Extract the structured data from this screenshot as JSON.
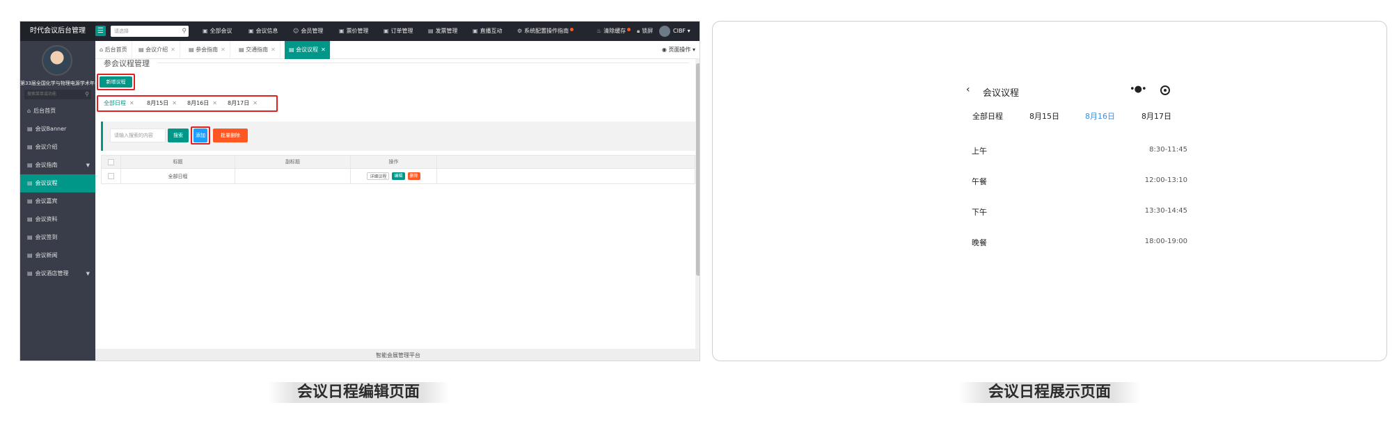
{
  "admin": {
    "brand": "时代会议后台管理",
    "top_search_placeholder": "请选择",
    "nav": [
      "全部会议",
      "会议信息",
      "会员管理",
      "票价管理",
      "订单管理",
      "发票管理",
      "直播互动",
      "系统配置",
      "操作指南",
      "清除缓存",
      "锁屏"
    ],
    "user": "CIBF",
    "sidebar": {
      "conference_name": "第33届全国化学与物理电源学术年会",
      "search_placeholder": "搜索菜单或功能",
      "items": [
        {
          "label": "后台首页"
        },
        {
          "label": "会议Banner"
        },
        {
          "label": "会议介绍"
        },
        {
          "label": "会议指南"
        },
        {
          "label": "会议议程"
        },
        {
          "label": "会议嘉宾"
        },
        {
          "label": "会议资料"
        },
        {
          "label": "会议签到"
        },
        {
          "label": "会议新闻"
        },
        {
          "label": "会议酒店管理"
        }
      ]
    },
    "tabs": [
      "后台首页",
      "会议介绍",
      "参会指南",
      "交通指南",
      "会议议程"
    ],
    "page_ops": "页面操作",
    "legend_title": "参会议程管理",
    "new_schedule": "新增议程",
    "date_tabs": [
      "全部日程",
      "8月15日",
      "8月16日",
      "8月17日"
    ],
    "toolbar": {
      "search_placeholder": "请输入搜索的内容",
      "search": "搜索",
      "add": "添加",
      "batch_delete": "批量删除"
    },
    "table": {
      "headers": [
        "标题",
        "副标题",
        "操作"
      ],
      "rows": [
        {
          "title": "全部日程",
          "subtitle": "",
          "detail": "详细议程",
          "edit": "编辑",
          "delete": "删除"
        }
      ]
    },
    "footer": "智能会展管理平台"
  },
  "display": {
    "title": "会议议程",
    "dates": [
      "全部日程",
      "8月15日",
      "8月16日",
      "8月17日"
    ],
    "active_date_index": 2,
    "slots": [
      {
        "label": "上午",
        "time": "8:30-11:45"
      },
      {
        "label": "午餐",
        "time": "12:00-13:10"
      },
      {
        "label": "下午",
        "time": "13:30-14:45"
      },
      {
        "label": "晚餐",
        "time": "18:00-19:00"
      }
    ]
  },
  "captions": {
    "left": "会议日程编辑页面",
    "right": "会议日程展示页面"
  },
  "colors": {
    "primary": "#009688",
    "danger": "#ff5722",
    "info": "#1e9fff",
    "highlight": "#e02020",
    "active_date": "#3b8de0"
  }
}
